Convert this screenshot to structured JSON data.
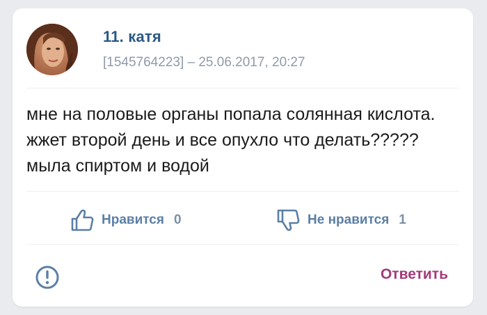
{
  "post": {
    "author": "11. катя",
    "meta": "[1545764223] – 25.06.2017, 20:27",
    "text": "мне на половые органы попала солянная кислота. жжет второй день и все опухло что делать????? мыла спиртом и водой"
  },
  "reactions": {
    "like_label": "Нравится",
    "like_count": "0",
    "dislike_label": "Не нравится",
    "dislike_count": "1"
  },
  "footer": {
    "reply_label": "Ответить"
  },
  "icons": {
    "like": "thumbs-up-icon",
    "dislike": "thumbs-down-icon",
    "report": "exclamation-circle-icon"
  },
  "colors": {
    "author": "#2a5885",
    "reaction": "#5b7fa6",
    "reply": "#a23a78",
    "meta": "#8e9aa8"
  }
}
